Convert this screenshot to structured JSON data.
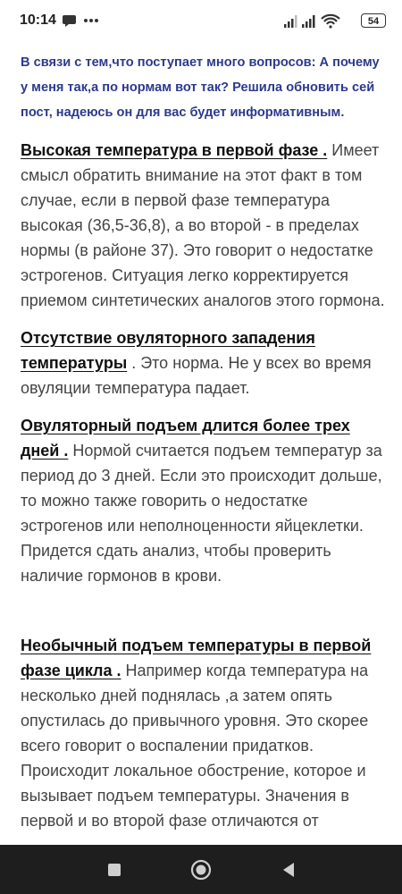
{
  "status_bar": {
    "time": "10:14",
    "battery": "54",
    "icons": [
      "chat-bubble-icon",
      "more-dots-icon",
      "signal-icon",
      "signal-icon",
      "wifi-icon",
      "battery-icon"
    ]
  },
  "post": {
    "intro": "В связи с тем,что поступает много вопросов: А почему у меня так,а по нормам вот так? Решила обновить сей пост, надеюсь он для вас будет информативным.",
    "sections": [
      {
        "heading": "Высокая температура в первой фазе .",
        "body": " Имеет смысл обратить внимание на этот факт в том случае, если в первой фазе температура высокая (36,5-36,8), а во второй - в пределах нормы (в районе 37). Это говорит о недостатке эстрогенов. Ситуация легко корректируется приемом синтетических аналогов этого гормона."
      },
      {
        "heading": "Отсутствие овуляторного западения температуры",
        "body": " . Это норма. Не у всех во время овуляции температура падает."
      },
      {
        "heading": "Овуляторный подъем длится более трех дней .",
        "body": " Нормой считается подъем температур за период до 3 дней. Если это происходит дольше, то можно также говорить о недостатке эстрогенов или неполноценности яйцеклетки. Придется сдать анализ, чтобы проверить наличие гормонов в крови."
      },
      {
        "heading": "Необычный подъем температуры в первой фазе цикла .",
        "body": " Например когда температура на несколько дней поднялась ,а затем опять опустилась до привычного уровня. Это скорее всего говорит о воспалении придатков. Происходит локальное обострение, которое и вызывает подъем температуры. Значения в первой и во второй фазе отличаются от"
      }
    ]
  },
  "nav_bar": {
    "icons": [
      "recents-square-icon",
      "home-circle-icon",
      "back-triangle-icon"
    ]
  },
  "colors": {
    "intro_text": "#2c3a8c",
    "body_text": "#444444",
    "heading_text": "#111111",
    "nav_background": "#1e1e1e"
  }
}
